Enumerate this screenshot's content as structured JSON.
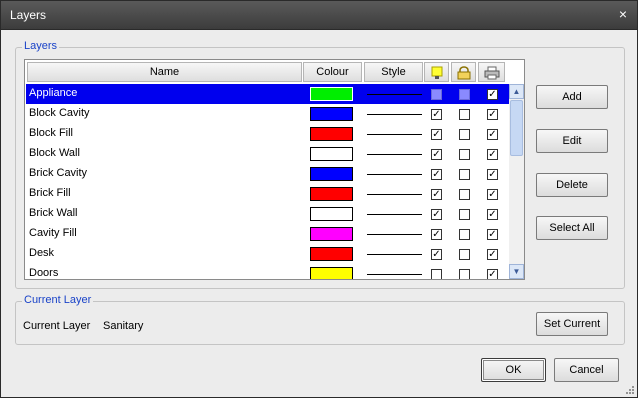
{
  "window": {
    "title": "Layers",
    "close_glyph": "×"
  },
  "layers_group": {
    "label": "Layers",
    "columns": {
      "name": "Name",
      "colour": "Colour",
      "style": "Style"
    },
    "header_icons": [
      "bulb-icon",
      "lock-icon",
      "printer-icon"
    ],
    "rows": [
      {
        "name": "Appliance",
        "colour": "#00ee00",
        "on": false,
        "locked": false,
        "print": true,
        "selected": true
      },
      {
        "name": "Block Cavity",
        "colour": "#0000ff",
        "on": true,
        "locked": false,
        "print": true
      },
      {
        "name": "Block Fill",
        "colour": "#ff0000",
        "on": true,
        "locked": false,
        "print": true
      },
      {
        "name": "Block Wall",
        "colour": "#ffffff",
        "on": true,
        "locked": false,
        "print": true
      },
      {
        "name": "Brick Cavity",
        "colour": "#0000ff",
        "on": true,
        "locked": false,
        "print": true
      },
      {
        "name": "Brick Fill",
        "colour": "#ff0000",
        "on": true,
        "locked": false,
        "print": true
      },
      {
        "name": "Brick Wall",
        "colour": "#ffffff",
        "on": true,
        "locked": false,
        "print": true
      },
      {
        "name": "Cavity Fill",
        "colour": "#ff00ff",
        "on": true,
        "locked": false,
        "print": true
      },
      {
        "name": "Desk",
        "colour": "#ff0000",
        "on": true,
        "locked": false,
        "print": true
      },
      {
        "name": "Doors",
        "colour": "#ffff00",
        "on": false,
        "locked": false,
        "print": true
      }
    ],
    "buttons": {
      "add": "Add",
      "edit": "Edit",
      "delete": "Delete",
      "select_all": "Select All"
    }
  },
  "current_layer_group": {
    "label": "Current Layer",
    "field_label": "Current Layer",
    "value": "Sanitary",
    "set_current": "Set Current"
  },
  "footer": {
    "ok": "OK",
    "cancel": "Cancel"
  }
}
